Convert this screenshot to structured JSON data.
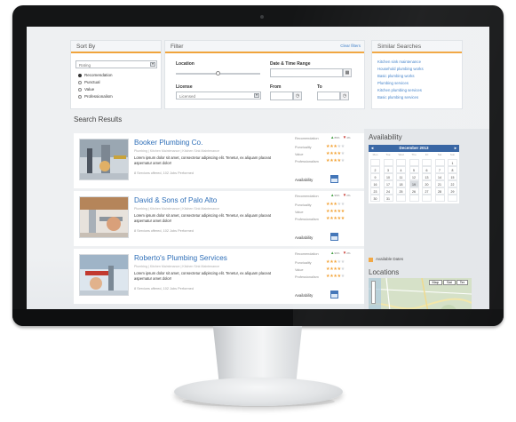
{
  "sort_by": {
    "title": "Sort By",
    "select_value": "Rating",
    "options": [
      "Recomendation",
      "Punctual",
      "Value",
      "Professionalism"
    ],
    "selected_index": 0
  },
  "filter": {
    "title": "Filter",
    "clear_label": "Clear filters",
    "location_label": "Location",
    "datetime_label": "Date & Time Range",
    "license_label": "License",
    "license_value": "Licensed",
    "from_label": "From",
    "to_label": "To"
  },
  "similar": {
    "title": "Similar Searches",
    "items": [
      "Kitchen sink maintenance",
      "Household plumbing works",
      "Basic plumbing works",
      "Plumbing services",
      "Kitchen plumbing services",
      "Basic plumbing services"
    ]
  },
  "results": {
    "title": "Search Results",
    "metric_labels": [
      "Recomendation",
      "Punctuality",
      "Value",
      "Professionalism"
    ],
    "availability_label": "Availability",
    "items": [
      {
        "name": "Booker Plumbing Co.",
        "subtitle": "Plumbing | Kitchen Maintenance | Kitchen Sink Maintenance",
        "description": "Lorem ipsum dolor sit amet, consectetur adipiscing elit. Tenetur, ex aliquam placeat aspernatur amet dolor!",
        "meta": "8 Services offered, 102 Jobs Performed",
        "up_pct": "86%",
        "down_pct": "4%",
        "ratings": [
          3,
          4,
          4
        ]
      },
      {
        "name": "David & Sons of Palo Alto",
        "subtitle": "Plumbing | Kitchen Maintenance | Kitchen Sink Maintenance",
        "description": "Lorem ipsum dolor sit amet, consectetur adipiscing elit. Tenetur, ex aliquam placeat aspernatur amet dolor!",
        "meta": "8 Services offered, 102 Jobs Performed",
        "up_pct": "96%",
        "down_pct": "2%",
        "ratings": [
          3,
          5,
          5
        ]
      },
      {
        "name": "Roberto's Plumbing Services",
        "subtitle": "Plumbing | Kitchen Maintenance | Kitchen Sink Maintenance",
        "description": "Lorem ipsum dolor sit amet, consectetur adipiscing elit. Tenetur, ex aliquam placeat aspernatur amet dolor!",
        "meta": "8 Services offered, 102 Jobs Performed",
        "up_pct": "90%",
        "down_pct": "2%",
        "ratings": [
          3,
          4,
          4
        ]
      }
    ]
  },
  "availability": {
    "title": "Availability",
    "month": "December 2013",
    "prev_icon": "chevron-left-icon",
    "next_icon": "chevron-right-icon",
    "days_of_week": [
      "Mon",
      "Tue",
      "Wed",
      "Thu",
      "Fri",
      "Sat",
      "Sun"
    ],
    "weeks": [
      [
        "",
        "",
        "",
        "",
        "",
        "",
        "1"
      ],
      [
        "2",
        "3",
        "4",
        "5",
        "6",
        "7",
        "8"
      ],
      [
        "9",
        "10",
        "11",
        "12",
        "13",
        "14",
        "15"
      ],
      [
        "16",
        "17",
        "18",
        "19",
        "20",
        "21",
        "22"
      ],
      [
        "23",
        "24",
        "25",
        "26",
        "27",
        "28",
        "29"
      ],
      [
        "30",
        "31",
        "",
        "",
        "",
        "",
        ""
      ]
    ],
    "highlighted_day": "19",
    "legend_label": "Available Dates"
  },
  "locations": {
    "title": "Locations",
    "map_buttons": [
      "Map",
      "Sat",
      "Ter"
    ]
  },
  "colors": {
    "accent": "#f0a43c",
    "link": "#3a7cc7",
    "calendar_header": "#2f5fa0",
    "star": "#f29d2a"
  }
}
